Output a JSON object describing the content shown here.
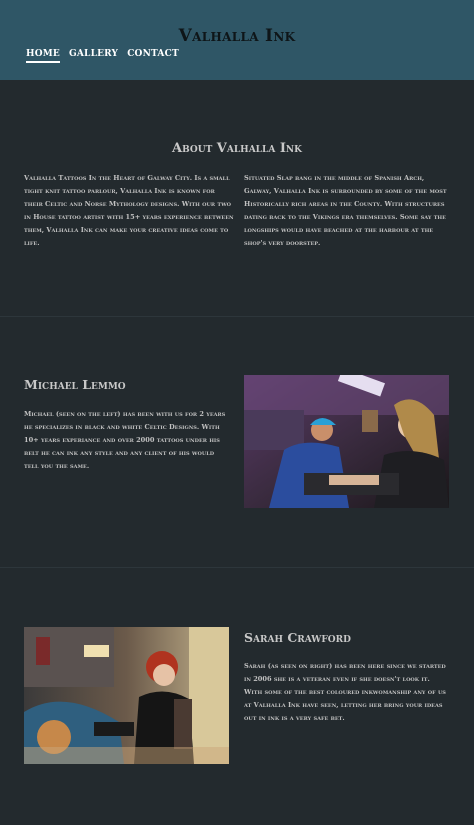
{
  "header": {
    "title": "Valhalla Ink",
    "nav": [
      {
        "label": "HOME"
      },
      {
        "label": "GALLERY"
      },
      {
        "label": "CONTACT"
      }
    ]
  },
  "about": {
    "title": "About Valhalla Ink",
    "left_text": "Valhalla Tattoos In the Heart of Galway City. Is a small tight knit tattoo parlour, Valhalla Ink is known for their Celtic and Norse Mythology designs. With our two in House tattoo artist with 15+ years experience between them, Valhalla Ink can make your creative ideas come to life.",
    "right_text": "Situated Slap bang in the middle of Spanish Arch, Galway, Valhalla Ink is surrounded by some of the most Historically rich areas in the County. With structures dating back to the Vikings era themselves. Some say the longships would have beached at the harbour at the shop's very doorstep."
  },
  "artists": [
    {
      "name": "Michael Lemmo",
      "bio": "Michael (seen on the left) has been with us for 2 years he specializes in black and white Celtic Designs. With 10+ years experiance and over 2000 tattoos under his belt he can ink any style and any client of his would tell you the same."
    },
    {
      "name": "Sarah Crawford",
      "bio": "Sarah (as seen on right) has been here since we started in 2006 she is a veteran even if she doesn't look it. With some of the best coloured inkwomanship any of us at Valhalla Ink have seen, letting her bring your ideas out in ink is a very safe bet."
    }
  ],
  "colors": {
    "header_bg": "#2f5666",
    "page_bg": "#232a2e",
    "title_text": "#0e1518",
    "nav_text": "#ffffff"
  }
}
